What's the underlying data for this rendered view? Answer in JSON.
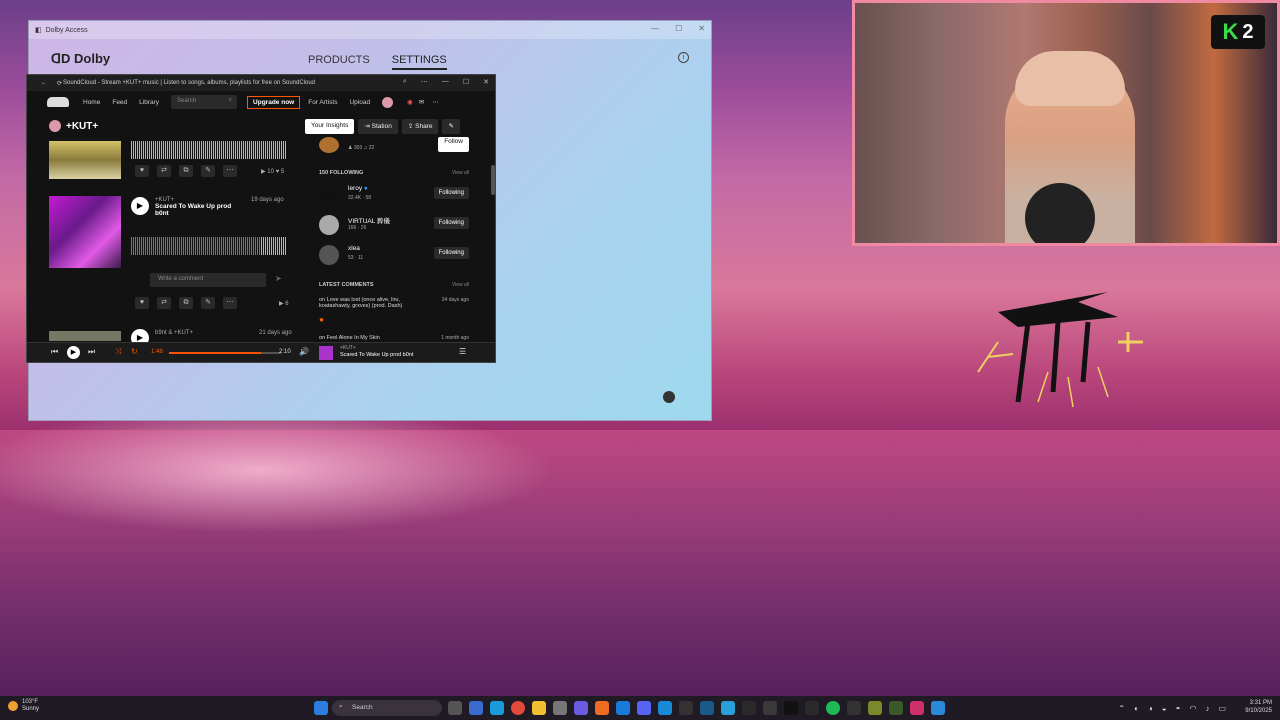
{
  "dolby": {
    "window_title": "Dolby Access",
    "brand": "Dolby",
    "nav": [
      "PRODUCTS",
      "SETTINGS"
    ]
  },
  "soundcloud": {
    "window_title": "SoundCloud - Stream +KUT+ music | Listen to songs, albums, playlists for free on SoundCloud",
    "nav": [
      "Home",
      "Feed",
      "Library"
    ],
    "search_placeholder": "Search",
    "upgrade_label": "Upgrade now",
    "for_artists": "For Artists",
    "upload": "Upload",
    "profile_name": "+KUT+",
    "action_buttons": [
      "Your Insights",
      "Station",
      "Share"
    ],
    "track1": {
      "plays": "10",
      "likes": "5"
    },
    "track2": {
      "artist": "+KUT+",
      "title": "Scared To Wake Up prod b0nt",
      "age": "19 days ago",
      "time": "2:10",
      "plays": "6"
    },
    "comment_placeholder": "Write a comment",
    "track3": {
      "artist": "b9nt & +KUT+",
      "age": "21 days ago"
    },
    "top_stats": {
      "followers": "303",
      "tracks": "22"
    },
    "follow_label": "Follow",
    "following_header": "150 FOLLOWING",
    "view_all": "View all",
    "following": [
      {
        "name": "leroy",
        "followers": "32.4K",
        "tracks": "58",
        "button": "Following"
      },
      {
        "name": "VIRTUAL 葬儀",
        "followers": "166",
        "tracks": "26",
        "button": "Following"
      },
      {
        "name": "xlea",
        "followers": "53",
        "tracks": "11",
        "button": "Following"
      }
    ],
    "comments_header": "LATEST COMMENTS",
    "comments": [
      {
        "text": "on Love was lost (once alive, liru, koatashawty, grxves) (prod. Dash)",
        "age": "24 days ago"
      },
      {
        "text": "on Feel Alone In My Skin",
        "age": "1 month ago"
      }
    ],
    "player": {
      "elapsed": "1:48",
      "duration": "2:10",
      "progress": 0.82,
      "now_artist": "+KUT+",
      "now_title": "Scared To Wake Up prod b0nt"
    }
  },
  "cam_badge": {
    "letter": "K",
    "number": "2"
  },
  "taskbar": {
    "temp": "103°F",
    "condition": "Sunny",
    "search": "Search",
    "time": "3:31 PM",
    "date": "9/10/2025"
  },
  "colors": {
    "accent": "#ff5500",
    "dolby_bg": "#c2bfe9",
    "badge_green": "#3bdc4a"
  }
}
